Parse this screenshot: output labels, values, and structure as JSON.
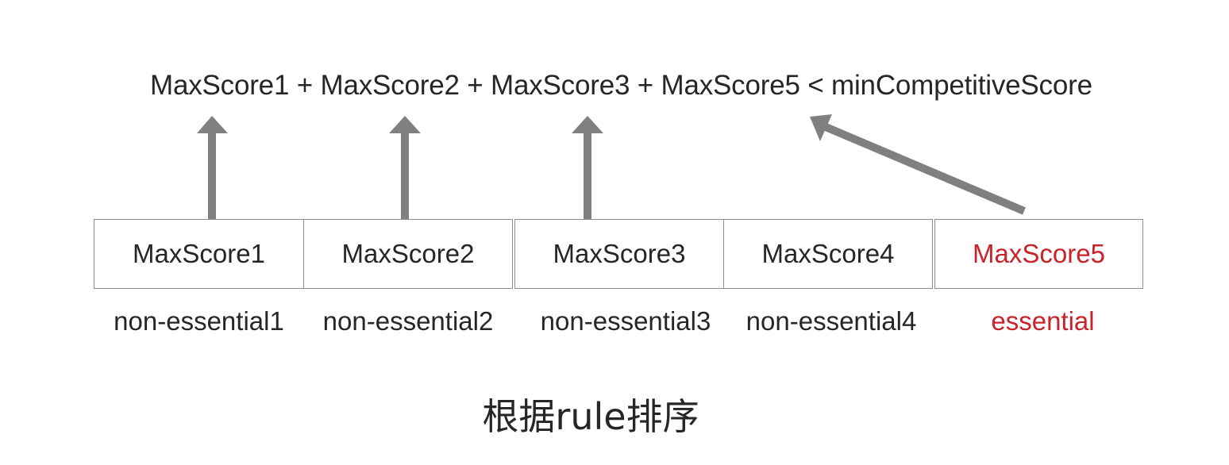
{
  "formula": "MaxScore1 + MaxScore2 + MaxScore3 + MaxScore5 < minCompetitiveScore",
  "cells": [
    {
      "label": "MaxScore1",
      "caption": "non-essential1",
      "highlight": false
    },
    {
      "label": "MaxScore2",
      "caption": "non-essential2",
      "highlight": false
    },
    {
      "label": "MaxScore3",
      "caption": "non-essential3",
      "highlight": false
    },
    {
      "label": "MaxScore4",
      "caption": "non-essential4",
      "highlight": false
    },
    {
      "label": "MaxScore5",
      "caption": "essential",
      "highlight": true
    }
  ],
  "title": "根据rule排序",
  "colors": {
    "text": "#262626",
    "highlight": "#c8222a",
    "arrow": "#808080",
    "border": "#8c8c8c"
  }
}
